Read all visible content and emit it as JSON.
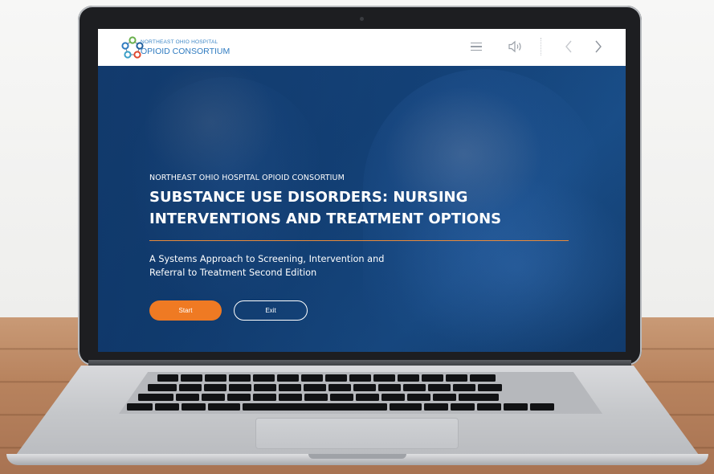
{
  "logo": {
    "line1": "NORTHEAST OHIO HOSPITAL",
    "line2": "OPIOID CONSORTIUM",
    "icon": "consortium-network-logo"
  },
  "toolbar": {
    "menu_icon": "hamburger-menu-icon",
    "sound_icon": "speaker-icon",
    "prev_icon": "chevron-left-icon",
    "next_icon": "chevron-right-icon"
  },
  "hero": {
    "kicker": "NORTHEAST OHIO HOSPITAL OPIOID CONSORTIUM",
    "title": "SUBSTANCE USE DISORDERS: NURSING INTERVENTIONS AND TREATMENT OPTIONS",
    "subtitle": "A Systems Approach to Screening, Intervention and Referral to Treatment Second Edition",
    "start_label": "Start",
    "exit_label": "Exit"
  },
  "colors": {
    "accent_orange": "#ef7a23",
    "rule_orange": "#e88a3a",
    "logo_blue": "#2f7bc0",
    "hero_blue": "#1a4f8a"
  }
}
